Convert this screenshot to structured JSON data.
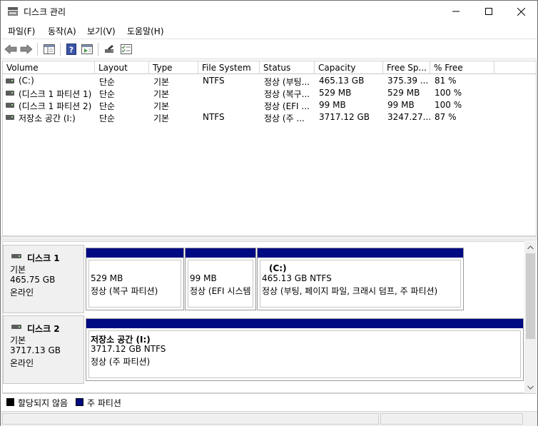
{
  "window": {
    "title": "디스크 관리"
  },
  "menu": [
    {
      "label": "파일(F)"
    },
    {
      "label": "동작(A)"
    },
    {
      "label": "보기(V)"
    },
    {
      "label": "도움말(H)"
    }
  ],
  "list": {
    "columns": [
      "Volume",
      "Layout",
      "Type",
      "File System",
      "Status",
      "Capacity",
      "Free Sp...",
      "% Free"
    ],
    "rows": [
      {
        "volume": "(C:)",
        "layout": "단순",
        "type": "기본",
        "fs": "NTFS",
        "status": "정상 (부팅...",
        "capacity": "465.13 GB",
        "free": "375.39 ...",
        "pct": "81 %"
      },
      {
        "volume": "(디스크 1 파티션 1)",
        "layout": "단순",
        "type": "기본",
        "fs": "",
        "status": "정상 (복구...",
        "capacity": "529 MB",
        "free": "529 MB",
        "pct": "100 %"
      },
      {
        "volume": "(디스크 1 파티션 2)",
        "layout": "단순",
        "type": "기본",
        "fs": "",
        "status": "정상 (EFI ...",
        "capacity": "99 MB",
        "free": "99 MB",
        "pct": "100 %"
      },
      {
        "volume": "저장소 공간 (I:)",
        "layout": "단순",
        "type": "기본",
        "fs": "NTFS",
        "status": "정상 (주 ...",
        "capacity": "3717.12 GB",
        "free": "3247.27...",
        "pct": "87 %"
      }
    ]
  },
  "disks": [
    {
      "name": "디스크 1",
      "type": "기본",
      "size": "465.75 GB",
      "state": "온라인",
      "partitions": [
        {
          "title": "",
          "size": "529 MB",
          "status": "정상 (복구 파티션)"
        },
        {
          "title": "",
          "size": "99 MB",
          "status": "정상 (EFI 시스템"
        },
        {
          "title": "(C:)",
          "size": "465.13 GB NTFS",
          "status": "정상 (부팅, 페이지 파일, 크래시 덤프, 주 파티션)"
        }
      ]
    },
    {
      "name": "디스크 2",
      "type": "기본",
      "size": "3717.13 GB",
      "state": "온라인",
      "partitions": [
        {
          "title": "저장소 공간  (I:)",
          "size": "3717.12 GB NTFS",
          "status": "정상 (주 파티션)"
        }
      ]
    }
  ],
  "legend": [
    {
      "label": "할당되지 않음",
      "color": "#000000"
    },
    {
      "label": "주 파티션",
      "color": "#000a83"
    }
  ]
}
